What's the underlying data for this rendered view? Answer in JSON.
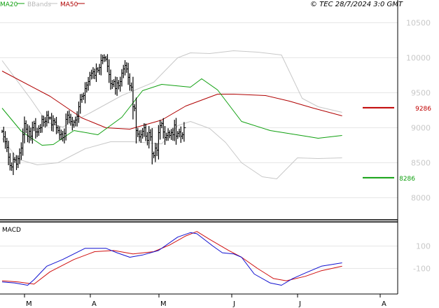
{
  "legend": [
    {
      "label": "MA20",
      "color": "#10a010"
    },
    {
      "label": "BBands",
      "color": "#c0c0c0"
    },
    {
      "label": "MA50",
      "color": "#b00000"
    }
  ],
  "copyright": "© TEC 28/7/2024 3:0 GMT",
  "macd_label": "MACD",
  "colors": {
    "price": "#000000",
    "ma20": "#10a010",
    "ma50": "#b00000",
    "bbands": "#c8c8c8",
    "macd": "#1010d0",
    "signal": "#d01010",
    "resistance": "#c00000",
    "support": "#10a010"
  },
  "chart_data": [
    {
      "type": "ohlc",
      "title": "",
      "x_ticks": [
        "M",
        "A",
        "M",
        "J",
        "J",
        "A"
      ],
      "ylim": [
        7700,
        10600
      ],
      "y_ticks": [
        8000,
        8500,
        9000,
        9500,
        10000,
        10500
      ],
      "y_tick_labels": [
        "8000",
        "8500",
        "9000",
        "9500",
        "10000",
        "10500"
      ],
      "grid": true,
      "close": [
        8950,
        8870,
        8800,
        8720,
        8580,
        8460,
        8440,
        8550,
        8540,
        8480,
        8560,
        8640,
        8710,
        8900,
        9060,
        8980,
        8880,
        8950,
        8880,
        9000,
        9060,
        8940,
        8940,
        8990,
        9000,
        9120,
        9080,
        9090,
        9180,
        9140,
        9140,
        9040,
        9100,
        9080,
        9000,
        8960,
        8900,
        8910,
        8860,
        8920,
        9120,
        9180,
        9150,
        9090,
        9040,
        9080,
        9110,
        9160,
        9300,
        9400,
        9450,
        9460,
        9560,
        9610,
        9660,
        9750,
        9780,
        9800,
        9750,
        9840,
        9820,
        9860,
        9960,
        10000,
        10000,
        9980,
        9880,
        9760,
        9630,
        9620,
        9660,
        9560,
        9640,
        9600,
        9660,
        9780,
        9840,
        9890,
        9840,
        9720,
        9600,
        9580,
        9300,
        9280,
        8960,
        8910,
        8870,
        8900,
        8950,
        9000,
        8880,
        8820,
        8930,
        8870,
        8630,
        8600,
        8710,
        8680,
        8930,
        9030,
        9060,
        8940,
        8860,
        8890,
        8930,
        8890,
        8930,
        8900,
        9040,
        8880,
        8920,
        8940,
        8880,
        8900,
        9000
      ],
      "series_lines": {
        "ma20": [
          [
            0,
            9280
          ],
          [
            12,
            8950
          ],
          [
            25,
            8750
          ],
          [
            32,
            8760
          ],
          [
            45,
            8960
          ],
          [
            60,
            8900
          ],
          [
            75,
            9150
          ],
          [
            88,
            9530
          ],
          [
            100,
            9620
          ],
          [
            118,
            9580
          ],
          [
            125,
            9700
          ],
          [
            135,
            9540
          ],
          [
            150,
            9090
          ],
          [
            168,
            8960
          ],
          [
            190,
            8880
          ],
          [
            198,
            8850
          ],
          [
            213,
            8890
          ]
        ],
        "ma50": [
          [
            0,
            9810
          ],
          [
            30,
            9450
          ],
          [
            50,
            9140
          ],
          [
            65,
            9000
          ],
          [
            80,
            8980
          ],
          [
            100,
            9110
          ],
          [
            115,
            9310
          ],
          [
            135,
            9480
          ],
          [
            145,
            9480
          ],
          [
            165,
            9460
          ],
          [
            180,
            9380
          ],
          [
            195,
            9280
          ],
          [
            213,
            9170
          ]
        ],
        "bb_upper": [
          [
            0,
            9960
          ],
          [
            18,
            9410
          ],
          [
            28,
            9080
          ],
          [
            38,
            9010
          ],
          [
            55,
            9210
          ],
          [
            75,
            9460
          ],
          [
            95,
            9650
          ],
          [
            110,
            10000
          ],
          [
            118,
            10070
          ],
          [
            130,
            10060
          ],
          [
            145,
            10100
          ],
          [
            160,
            10080
          ],
          [
            175,
            10040
          ],
          [
            188,
            9420
          ],
          [
            198,
            9300
          ],
          [
            213,
            9220
          ]
        ],
        "bb_lower": [
          [
            0,
            8850
          ],
          [
            10,
            8550
          ],
          [
            22,
            8470
          ],
          [
            35,
            8500
          ],
          [
            52,
            8700
          ],
          [
            68,
            8800
          ],
          [
            82,
            8800
          ],
          [
            100,
            8770
          ],
          [
            110,
            9030
          ],
          [
            118,
            9090
          ],
          [
            130,
            8990
          ],
          [
            140,
            8790
          ],
          [
            150,
            8500
          ],
          [
            163,
            8300
          ],
          [
            172,
            8270
          ],
          [
            185,
            8570
          ],
          [
            198,
            8560
          ],
          [
            213,
            8570
          ]
        ],
        "resistance": {
          "value": 9286,
          "label": "9286"
        },
        "support": {
          "value": 8286,
          "label": "8286"
        }
      }
    },
    {
      "type": "line",
      "title": "MACD",
      "ylim": [
        -300,
        330
      ],
      "y_ticks": [
        100,
        -100
      ],
      "y_tick_labels": [
        "100",
        "-100"
      ],
      "series": [
        {
          "name": "MACD",
          "points": [
            [
              0,
              -220
            ],
            [
              8,
              -230
            ],
            [
              16,
              -250
            ],
            [
              20,
              -200
            ],
            [
              28,
              -80
            ],
            [
              38,
              -20
            ],
            [
              52,
              80
            ],
            [
              65,
              80
            ],
            [
              72,
              40
            ],
            [
              80,
              0
            ],
            [
              88,
              20
            ],
            [
              98,
              60
            ],
            [
              110,
              180
            ],
            [
              118,
              220
            ],
            [
              122,
              210
            ],
            [
              132,
              100
            ],
            [
              138,
              40
            ],
            [
              145,
              30
            ],
            [
              150,
              0
            ],
            [
              158,
              -150
            ],
            [
              168,
              -230
            ],
            [
              175,
              -250
            ],
            [
              182,
              -190
            ],
            [
              190,
              -140
            ],
            [
              200,
              -80
            ],
            [
              213,
              -50
            ]
          ]
        },
        {
          "name": "Signal",
          "points": [
            [
              0,
              -210
            ],
            [
              10,
              -220
            ],
            [
              20,
              -240
            ],
            [
              30,
              -130
            ],
            [
              45,
              -20
            ],
            [
              58,
              50
            ],
            [
              70,
              60
            ],
            [
              82,
              30
            ],
            [
              95,
              50
            ],
            [
              105,
              110
            ],
            [
              115,
              190
            ],
            [
              122,
              230
            ],
            [
              130,
              160
            ],
            [
              142,
              60
            ],
            [
              150,
              0
            ],
            [
              160,
              -100
            ],
            [
              170,
              -190
            ],
            [
              178,
              -210
            ],
            [
              190,
              -170
            ],
            [
              200,
              -120
            ],
            [
              213,
              -80
            ]
          ]
        }
      ]
    }
  ]
}
